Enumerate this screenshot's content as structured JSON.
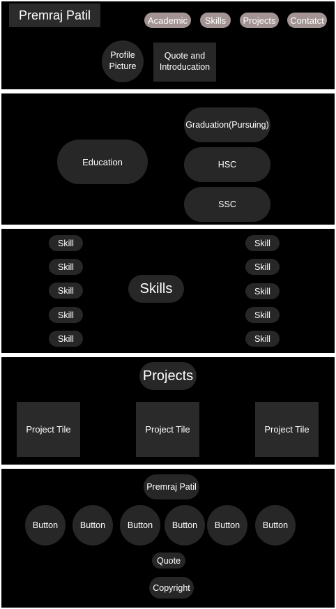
{
  "header": {
    "brand": "Premraj Patil",
    "nav": [
      "Academic",
      "Skills",
      "Projects",
      "Contatct"
    ],
    "profile": "Profile Picture",
    "quote": "Quote and Introducation"
  },
  "academic": {
    "education": "Education",
    "items": [
      "Graduation(Pursuing)",
      "HSC",
      "SSC"
    ]
  },
  "skills": {
    "title": "Skills",
    "left": [
      "Skill",
      "Skill",
      "Skill",
      "Skill",
      "Skill"
    ],
    "right": [
      "Skill",
      "Skill",
      "Skill",
      "Skill",
      "Skill"
    ]
  },
  "projects": {
    "title": "Projects",
    "tiles": [
      "Project Tile",
      "Project Tile",
      "Project Tile"
    ]
  },
  "footer": {
    "name": "Premraj Patil",
    "buttons": [
      "Button",
      "Button",
      "Button",
      "Button",
      "Button",
      "Button"
    ],
    "quote": "Quote",
    "copyright": "Copyright"
  }
}
